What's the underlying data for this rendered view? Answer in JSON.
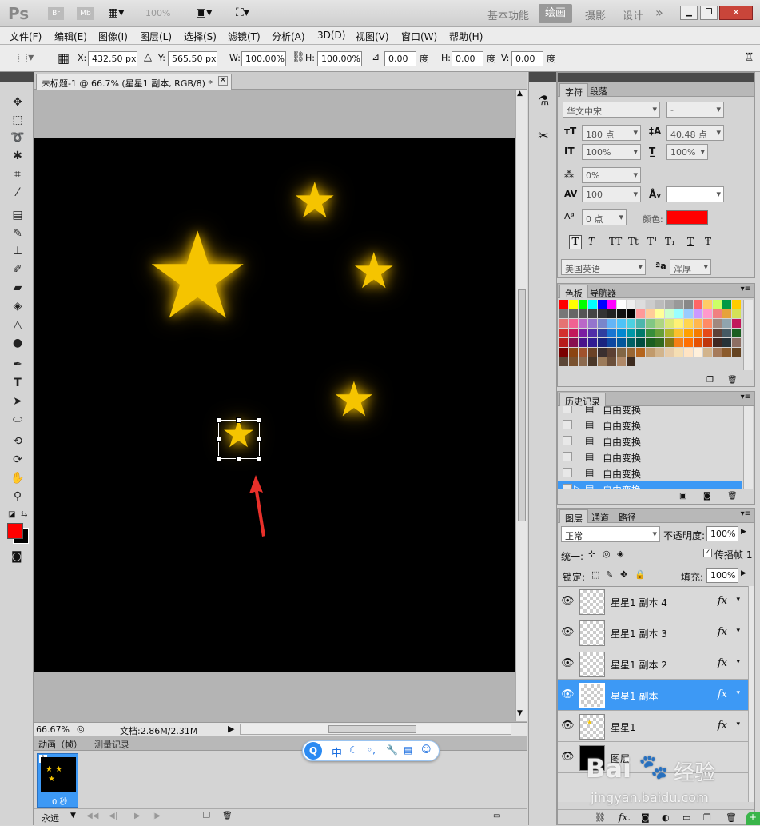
{
  "app": {
    "logo": "Ps",
    "badges": [
      "Br",
      "Mb"
    ],
    "zoom_display": "100%"
  },
  "workspaces": [
    "基本功能",
    "绘画",
    "摄影",
    "设计"
  ],
  "workspace_more": "»",
  "menu": [
    "文件(F)",
    "编辑(E)",
    "图像(I)",
    "图层(L)",
    "选择(S)",
    "滤镜(T)",
    "分析(A)",
    "3D(D)",
    "视图(V)",
    "窗口(W)",
    "帮助(H)"
  ],
  "options": {
    "x_label": "X:",
    "x_value": "432.50 px",
    "y_label": "Y:",
    "y_value": "565.50 px",
    "w_label": "W:",
    "w_value": "100.00%",
    "h_label": "H:",
    "h_value": "100.00%",
    "angle_value": "0.00",
    "angle_unit": "度",
    "hskew_label": "H:",
    "hskew_value": "0.00",
    "hskew_unit": "度",
    "vskew_label": "V:",
    "vskew_value": "0.00",
    "vskew_unit": "度"
  },
  "document": {
    "tab_title": "未标题-1 @ 66.7% (星星1 副本, RGB/8) *",
    "zoom": "66.67%",
    "doc_size": "文档:2.86M/2.31M"
  },
  "bottom_panel": {
    "tabs": [
      "动画（帧）",
      "测量记录"
    ],
    "frame_number": "1",
    "frame_delay": "0 秒",
    "loop": "永远"
  },
  "im_toolbar": {
    "label_zh": "中",
    "label_dots": "◦,"
  },
  "character_panel": {
    "tabs": [
      "字符",
      "段落"
    ],
    "font_family": "华文中宋",
    "font_style": "-",
    "font_size": "180 点",
    "leading": "40.48 点",
    "vscale": "100%",
    "hscale": "100%",
    "tsume": "0%",
    "tracking": "100",
    "kerning": "",
    "baseline": "0 点",
    "color_label": "颜色:",
    "color": "#ff0000",
    "style_buttons": [
      "T",
      "T",
      "TT",
      "Tt",
      "T¹",
      "T₁",
      "T",
      "Ŧ"
    ],
    "language": "美国英语",
    "aa_label": "ªa",
    "antialias": "浑厚"
  },
  "swatches_panel": {
    "tabs": [
      "色板",
      "导航器"
    ]
  },
  "history_panel": {
    "tabs": [
      "历史记录"
    ],
    "items": [
      "自由变换",
      "自由变换",
      "自由变换",
      "自由变换",
      "自由变换",
      "自由变换"
    ]
  },
  "layers_panel": {
    "tabs": [
      "图层",
      "通道",
      "路径"
    ],
    "blend_mode": "正常",
    "opacity_label": "不透明度:",
    "opacity": "100%",
    "unify_label": "统一:",
    "propagate_label": "传播帧 1",
    "lock_label": "锁定:",
    "fill_label": "填充:",
    "fill": "100%",
    "layers": [
      {
        "name": "星星1 副本 4",
        "selected": false,
        "fx": "fx"
      },
      {
        "name": "星星1 副本 3",
        "selected": false,
        "fx": "fx"
      },
      {
        "name": "星星1 副本 2",
        "selected": false,
        "fx": "fx"
      },
      {
        "name": "星星1 副本",
        "selected": true,
        "fx": "fx"
      },
      {
        "name": "星星1",
        "selected": false,
        "fx": "fx"
      },
      {
        "name": "图层",
        "selected": false,
        "fx": ""
      }
    ]
  },
  "watermark": {
    "brand": "Bai",
    "brand2": "经验",
    "url": "jingyan.baidu.com"
  }
}
